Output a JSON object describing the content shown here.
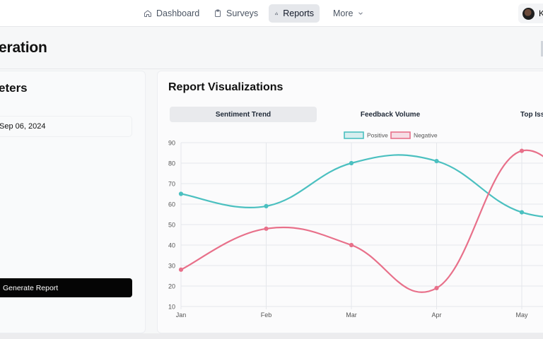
{
  "nav": {
    "items": [
      {
        "label": "Dashboard",
        "icon": "home-icon"
      },
      {
        "label": "Surveys",
        "icon": "clipboard-icon"
      },
      {
        "label": "Reports",
        "icon": "bar-chart-icon",
        "active": true
      },
      {
        "label": "More",
        "icon": "chevron-down-icon"
      }
    ],
    "user_initial": "K"
  },
  "page": {
    "title": "eration"
  },
  "params": {
    "heading": "eters",
    "date_value": "Sep 06, 2024",
    "generate_label": "Generate Report"
  },
  "viz": {
    "title": "Report Visualizations",
    "tabs": [
      "Sentiment Trend",
      "Feedback Volume",
      "Top Iss"
    ]
  },
  "chart_data": {
    "type": "line",
    "categories": [
      "Jan",
      "Feb",
      "Mar",
      "Apr",
      "May"
    ],
    "series": [
      {
        "name": "Positive",
        "values": [
          65,
          59,
          80,
          81,
          56
        ],
        "color": "#4bc0c0"
      },
      {
        "name": "Negative",
        "values": [
          28,
          48,
          40,
          19,
          86
        ],
        "color": "#e8708a"
      }
    ],
    "ylim": [
      10,
      90
    ],
    "yticks": [
      10,
      20,
      30,
      40,
      50,
      60,
      70,
      80,
      90
    ],
    "grid": true,
    "legend": "top-center"
  }
}
